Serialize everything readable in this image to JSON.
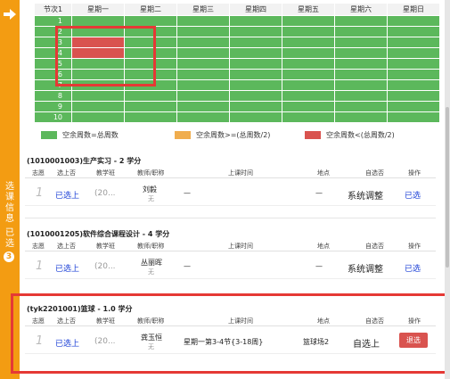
{
  "sidebar": {
    "labels": [
      "选",
      "课",
      "信",
      "息",
      "已",
      "选"
    ],
    "badge": "3"
  },
  "schedule": {
    "header": [
      "节次1",
      "星期一",
      "星期二",
      "星期三",
      "星期四",
      "星期五",
      "星期六",
      "星期日"
    ],
    "periods": [
      "1",
      "2",
      "3",
      "4",
      "5",
      "6",
      "7",
      "8",
      "9",
      "10"
    ]
  },
  "legend": [
    {
      "color": "#5cb85c",
      "label": "空余周数=总周数"
    },
    {
      "color": "#f0ad4e",
      "label": "空余周数>=(总周数/2)"
    },
    {
      "color": "#d9534f",
      "label": "空余周数<(总周数/2)"
    }
  ],
  "table_headers": {
    "volunteer": "志愿",
    "selected": "选上否",
    "class": "教学班",
    "teacher": "教师/职称",
    "time": "上课时间",
    "location": "地点",
    "mode": "自选否",
    "op": "操作"
  },
  "courses": [
    {
      "title": "(1010001003)生产实习 - 2 学分",
      "volunteer": "1",
      "selected": "已选上",
      "class": "(20...",
      "teacher": "刘毅",
      "teacher_title": "无",
      "time": "—",
      "location": "—",
      "mode": "系统调整",
      "action": "已选"
    },
    {
      "title": "(1010001205)软件综合课程设计 - 4 学分",
      "volunteer": "1",
      "selected": "已选上",
      "class": "(20...",
      "teacher": "丛丽晖",
      "teacher_title": "无",
      "time": "—",
      "location": "—",
      "mode": "系统调整",
      "action": "已选"
    },
    {
      "title": "(tyk2201001)篮球 - 1.0 学分",
      "volunteer": "1",
      "selected": "已选上",
      "class": "(20...",
      "teacher": "龚玉恒",
      "teacher_title": "无",
      "time": "星期一第3-4节{3-18周}",
      "location": "篮球场2",
      "mode": "自选上",
      "action": "退选"
    }
  ]
}
